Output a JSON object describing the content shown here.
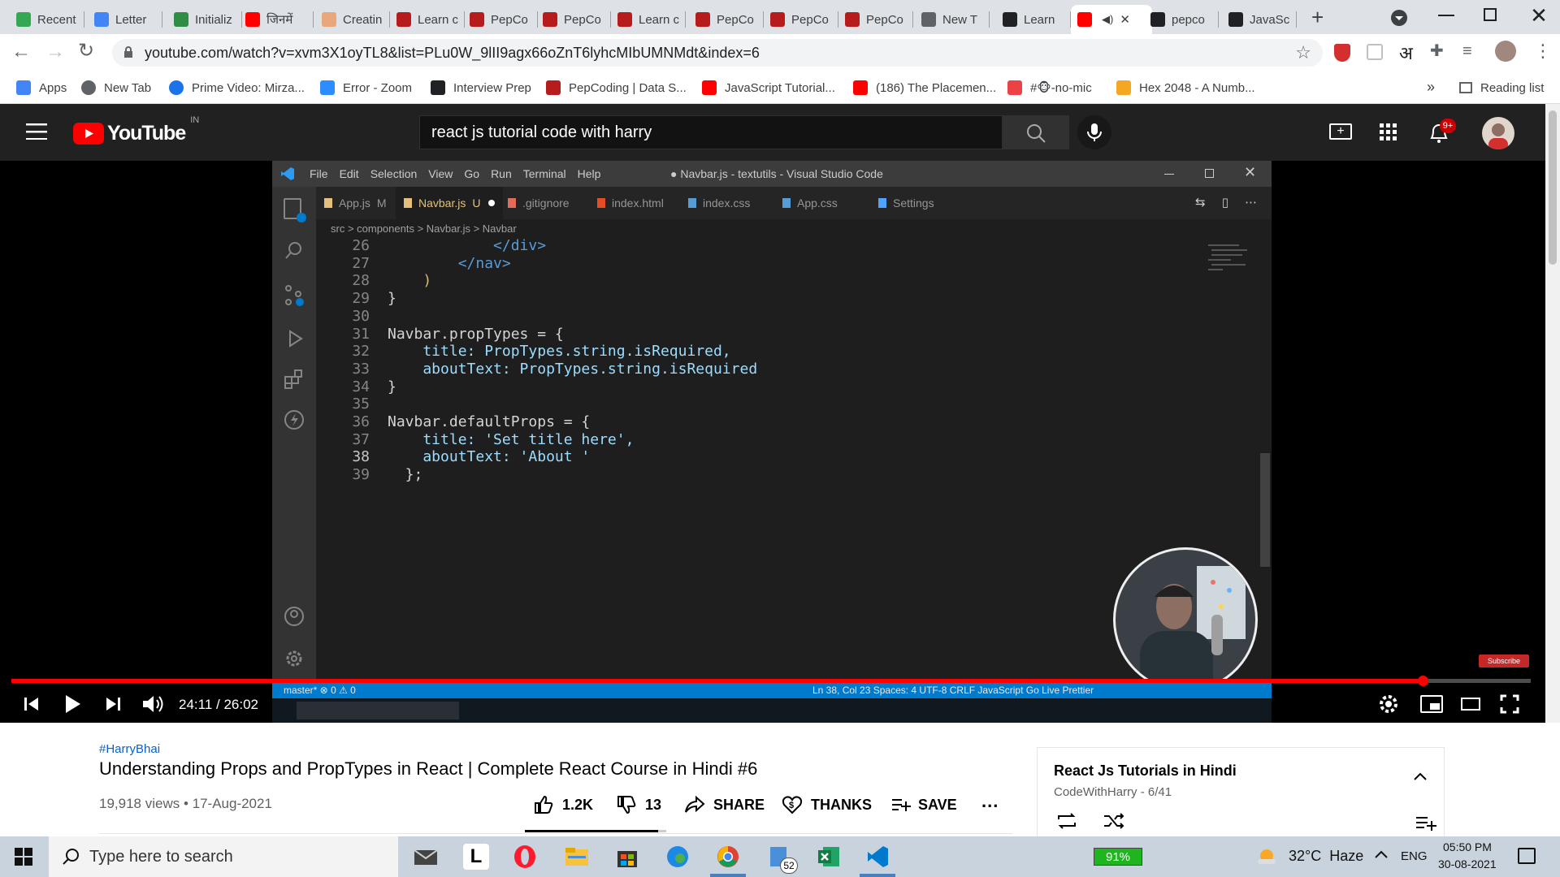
{
  "browser": {
    "tabs": [
      {
        "label": "Recent",
        "color": "#34a853"
      },
      {
        "label": "Letter",
        "color": "#4285f4"
      },
      {
        "label": "Initializ",
        "color": "#2f8d46"
      },
      {
        "label": "जिनमें ",
        "color": "#ff0000"
      },
      {
        "label": "Creatin",
        "color": "#e8a87c"
      },
      {
        "label": "Learn c",
        "color": "#b71c1c"
      },
      {
        "label": "PepCo",
        "color": "#b71c1c"
      },
      {
        "label": "PepCo",
        "color": "#b71c1c"
      },
      {
        "label": "Learn c",
        "color": "#b71c1c"
      },
      {
        "label": "PepCo",
        "color": "#b71c1c"
      },
      {
        "label": "PepCo",
        "color": "#b71c1c"
      },
      {
        "label": "PepCo",
        "color": "#b71c1c"
      },
      {
        "label": "New T",
        "color": "#5f6368"
      },
      {
        "label": "Learn",
        "color": "#202124"
      },
      {
        "label": "",
        "color": "#ff0000"
      },
      {
        "label": "pepco",
        "color": "#202124"
      },
      {
        "label": "JavaSc",
        "color": "#202124"
      }
    ],
    "url": "youtube.com/watch?v=xvm3X1oyTL8&list=PLu0W_9lII9agx66oZnT6lyhcMIbUMNMdt&index=6",
    "bookmarks": [
      {
        "label": "Apps",
        "color": "#4285f4"
      },
      {
        "label": "New Tab",
        "color": "#5f6368"
      },
      {
        "label": "Prime Video: Mirza...",
        "color": "#1a73e8"
      },
      {
        "label": "Error - Zoom",
        "color": "#2d8cff"
      },
      {
        "label": "Interview Prep",
        "color": "#202124"
      },
      {
        "label": "PepCoding | Data S...",
        "color": "#b71c1c"
      },
      {
        "label": "JavaScript Tutorial...",
        "color": "#ff0000"
      },
      {
        "label": "(186) The Placemen...",
        "color": "#ff0000"
      },
      {
        "label": "#🐵-no-mic",
        "color": "#ed4245"
      },
      {
        "label": "Hex 2048 - A Numb...",
        "color": "#f5a623"
      }
    ],
    "more_bookmarks": "»",
    "reading_list": "Reading list",
    "ext_hindi": "अ"
  },
  "youtube": {
    "logo_text": "YouTube",
    "region": "IN",
    "search_query": "react js tutorial code with harry",
    "notif_badge": "9+"
  },
  "vscode": {
    "menu": [
      "File",
      "Edit",
      "Selection",
      "View",
      "Go",
      "Run",
      "Terminal",
      "Help"
    ],
    "title": "● Navbar.js - textutils - Visual Studio Code",
    "tabs": [
      {
        "label": "App.js",
        "suffix": "M"
      },
      {
        "label": "Navbar.js",
        "suffix": "U"
      },
      {
        "label": ".gitignore",
        "suffix": ""
      },
      {
        "label": "index.html",
        "suffix": ""
      },
      {
        "label": "index.css",
        "suffix": ""
      },
      {
        "label": "App.css",
        "suffix": ""
      },
      {
        "label": "Settings",
        "suffix": ""
      }
    ],
    "breadcrumb": "src > components > Navbar.js > Navbar",
    "code_lines": [
      {
        "n": "26",
        "t": "            </div>"
      },
      {
        "n": "27",
        "t": "        </nav>"
      },
      {
        "n": "28",
        "t": "    )"
      },
      {
        "n": "29",
        "t": "}"
      },
      {
        "n": "30",
        "t": ""
      },
      {
        "n": "31",
        "t": "Navbar.propTypes = {"
      },
      {
        "n": "32",
        "t": "    title: PropTypes.string.isRequired,"
      },
      {
        "n": "33",
        "t": "    aboutText: PropTypes.string.isRequired"
      },
      {
        "n": "34",
        "t": "}"
      },
      {
        "n": "35",
        "t": ""
      },
      {
        "n": "36",
        "t": "Navbar.defaultProps = {"
      },
      {
        "n": "37",
        "t": "    title: 'Set title here',"
      },
      {
        "n": "38",
        "t": "    aboutText: 'About '"
      },
      {
        "n": "39",
        "t": "  };"
      }
    ],
    "status_left": "master*   ⊗ 0 ⚠ 0",
    "status_right": "Ln 38, Col 23    Spaces: 4    UTF-8    CRLF    JavaScript    Go Live    Prettier",
    "subscribe_label": "Subscribe"
  },
  "player": {
    "time": "24:11 / 26:02",
    "progress_fraction": 0.929
  },
  "video": {
    "hashtag": "#HarryBhai",
    "title": "Understanding Props and PropTypes in React | Complete React Course in Hindi #6",
    "views": "19,918 views • 17-Aug-2021",
    "likes": "1.2K",
    "dislikes": "13",
    "share": "SHARE",
    "thanks": "THANKS",
    "save": "SAVE",
    "more": "..."
  },
  "playlist": {
    "title": "React Js Tutorials in Hindi",
    "subtitle": "CodeWithHarry - 6/41"
  },
  "taskbar": {
    "search_placeholder": "Type here to search",
    "battery": "91%",
    "weather": "32°C  Haze",
    "lang": "ENG",
    "time": "05:50 PM",
    "date": "30-08-2021",
    "badge": "52"
  }
}
